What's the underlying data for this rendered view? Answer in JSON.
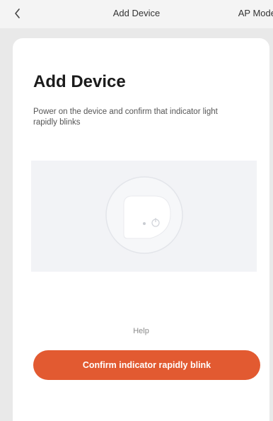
{
  "nav": {
    "title": "Add Device",
    "mode_label": "AP Mode"
  },
  "card": {
    "title": "Add Device",
    "description": "Power on the device and confirm that indicator light rapidly blinks",
    "help_label": "Help",
    "confirm_label": "Confirm indicator rapidly blink"
  },
  "colors": {
    "accent": "#e25a31",
    "background": "#e9e9e9",
    "card": "#ffffff",
    "illustration_bg": "#f2f3f6"
  },
  "icons": {
    "back": "chevron-left-icon",
    "device": "smart-plug-icon",
    "power": "power-icon"
  }
}
